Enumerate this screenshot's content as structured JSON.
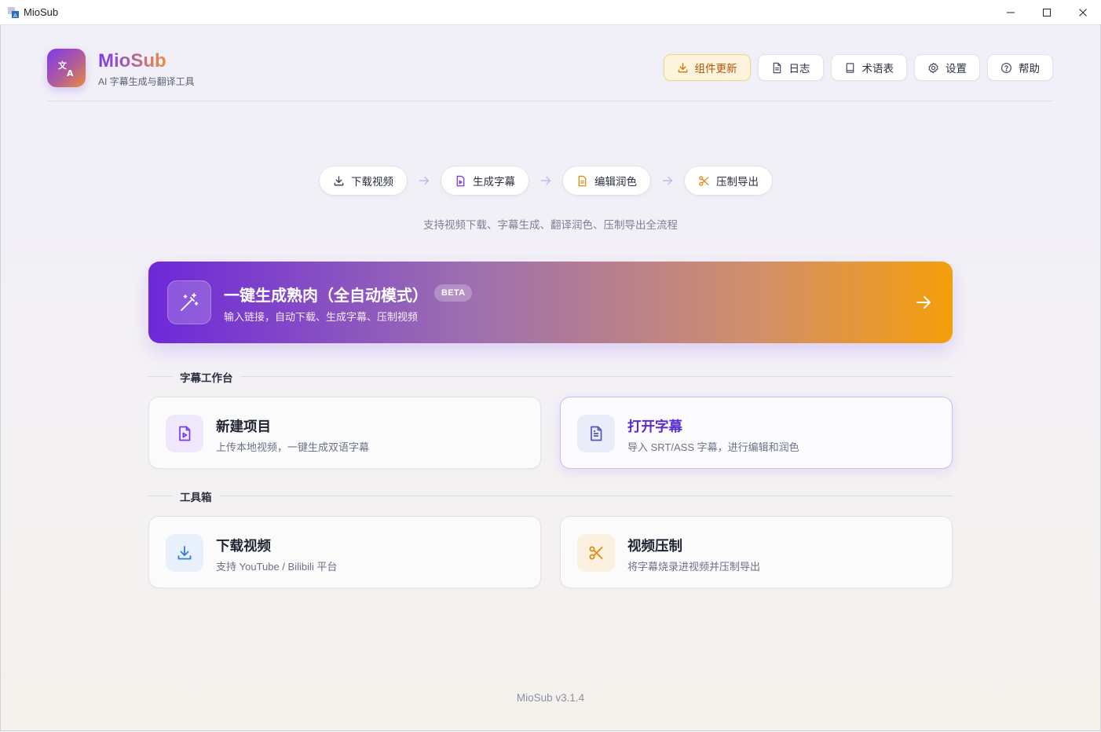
{
  "window": {
    "title": "MioSub"
  },
  "header": {
    "brand_name": "MioSub",
    "brand_subtitle": "AI 字幕生成与翻译工具",
    "buttons": [
      {
        "label": "组件更新",
        "icon": "download-icon"
      },
      {
        "label": "日志",
        "icon": "file-text-icon"
      },
      {
        "label": "术语表",
        "icon": "book-icon"
      },
      {
        "label": "设置",
        "icon": "gear-icon"
      },
      {
        "label": "帮助",
        "icon": "help-circle-icon"
      }
    ]
  },
  "workflow": {
    "steps": [
      {
        "label": "下载视频",
        "icon": "download-icon"
      },
      {
        "label": "生成字幕",
        "icon": "file-video-icon"
      },
      {
        "label": "编辑润色",
        "icon": "file-text-icon"
      },
      {
        "label": "压制导出",
        "icon": "scissors-icon"
      }
    ],
    "tagline": "支持视频下载、字幕生成、翻译润色、压制导出全流程"
  },
  "hero": {
    "title": "一键生成熟肉（全自动模式）",
    "badge": "BETA",
    "subtitle": "输入链接，自动下载、生成字幕、压制视频"
  },
  "sections": {
    "workbench": {
      "label": "字幕工作台",
      "cards": [
        {
          "title": "新建项目",
          "subtitle": "上传本地视频，一键生成双语字幕",
          "icon": "file-video-icon"
        },
        {
          "title": "打开字幕",
          "subtitle": "导入 SRT/ASS 字幕，进行编辑和润色",
          "icon": "file-text-icon"
        }
      ]
    },
    "toolbox": {
      "label": "工具箱",
      "cards": [
        {
          "title": "下载视频",
          "subtitle": "支持 YouTube / Bilibili 平台",
          "icon": "download-icon"
        },
        {
          "title": "视频压制",
          "subtitle": "将字幕烧录进视频并压制导出",
          "icon": "scissors-icon"
        }
      ]
    }
  },
  "footer": {
    "version": "MioSub v3.1.4"
  },
  "colors": {
    "accent_purple": "#7c3aed",
    "accent_orange": "#f59e0b",
    "update_text": "#b45309",
    "update_bg": "#fdf4dd"
  }
}
